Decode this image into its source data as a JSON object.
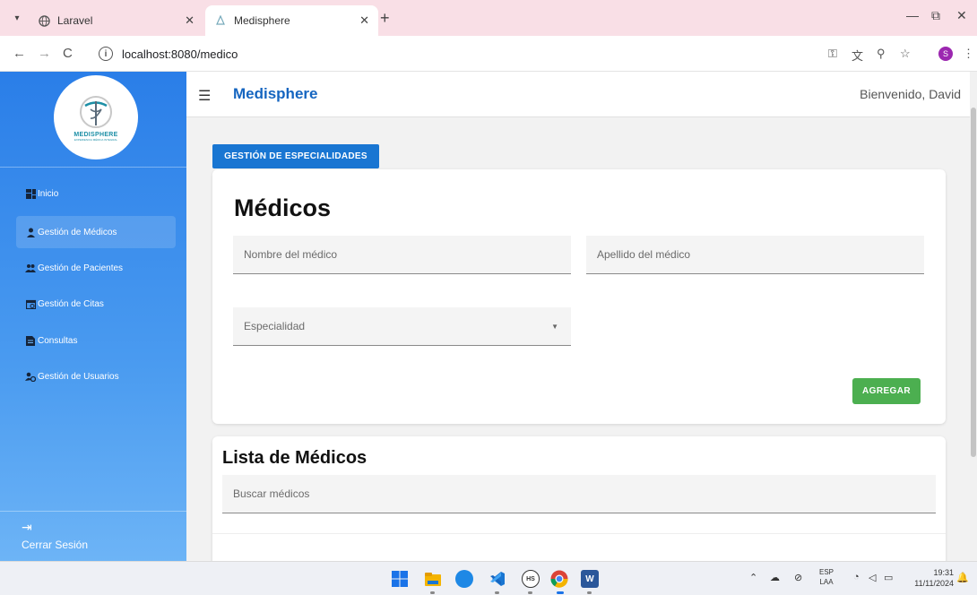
{
  "browser": {
    "tabs": [
      {
        "title": "Laravel",
        "favicon": "globe-icon",
        "active": false
      },
      {
        "title": "Medisphere",
        "favicon": "medisphere-icon",
        "active": true
      }
    ],
    "new_tab": "+",
    "url": "localhost:8080/medico",
    "profile_initial": "S",
    "nav": {
      "back": "←",
      "forward": "→",
      "reload": "C"
    }
  },
  "sidebar": {
    "logo_text": "MEDISPHERE",
    "logo_sub": "EXPERIENCIA MÉDICA INTEGRAL",
    "items": [
      {
        "label": "Inicio",
        "icon": "dashboard-icon"
      },
      {
        "label": "Gestión de Médicos",
        "icon": "doctor-icon",
        "selected": true
      },
      {
        "label": "Gestión de Pacientes",
        "icon": "patients-icon"
      },
      {
        "label": "Gestión de Citas",
        "icon": "calendar-icon"
      },
      {
        "label": "Consultas",
        "icon": "document-icon"
      },
      {
        "label": "Gestión de Usuarios",
        "icon": "users-settings-icon"
      }
    ],
    "logout": "Cerrar Sesión"
  },
  "appbar": {
    "brand": "Medisphere",
    "welcome": "Bienvenido, David"
  },
  "main": {
    "specialties_button": "GESTIÓN DE ESPECIALIDADES",
    "form": {
      "title": "Médicos",
      "first_name_placeholder": "Nombre del médico",
      "last_name_placeholder": "Apellido del médico",
      "specialty_placeholder": "Especialidad",
      "add_button": "AGREGAR"
    },
    "list": {
      "title": "Lista de Médicos",
      "search_placeholder": "Buscar médicos"
    }
  },
  "taskbar": {
    "language": "ESP",
    "region": "LAA",
    "time": "19:31",
    "date": "11/11/2024"
  },
  "colors": {
    "primary": "#1976d2",
    "brand": "#1565c0",
    "success": "#4caf50",
    "sidebar_top": "#2a7ee8",
    "sidebar_bottom": "#6db4f6"
  }
}
